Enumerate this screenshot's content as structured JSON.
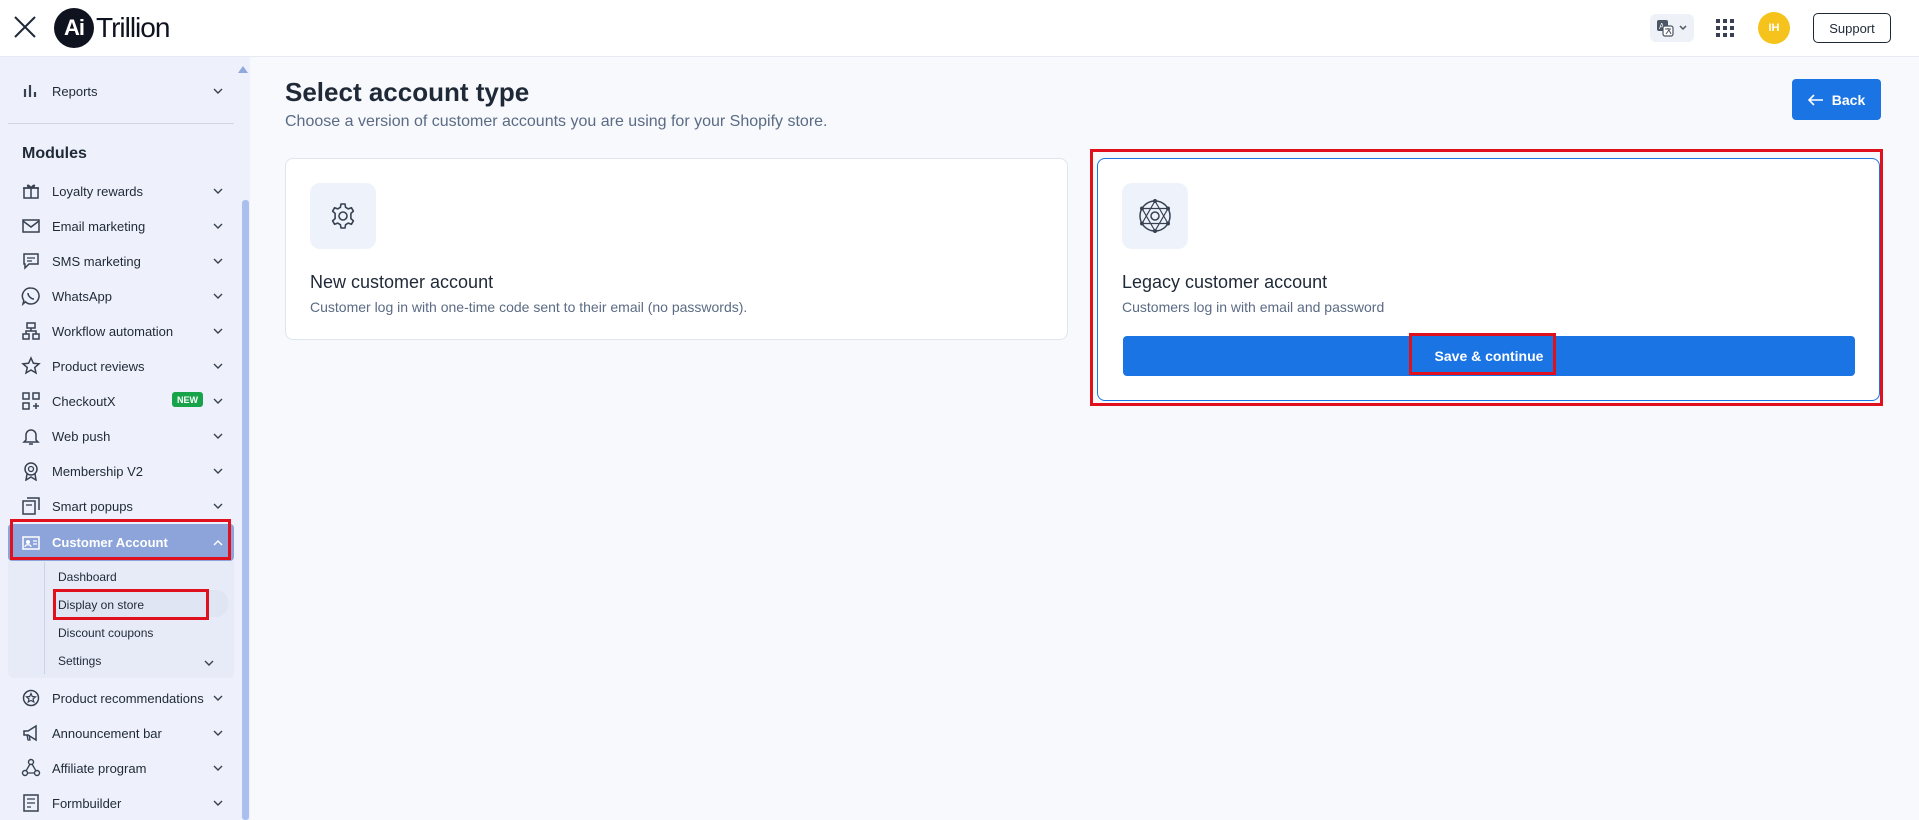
{
  "header": {
    "logo_mark": "Ai",
    "logo_text": "Trillion",
    "avatar_initials": "IH",
    "support_label": "Support"
  },
  "sidebar": {
    "top_item": "Reports",
    "modules_title": "Modules",
    "items": [
      {
        "label": "Loyalty rewards",
        "icon": "gift-icon"
      },
      {
        "label": "Email marketing",
        "icon": "mail-icon"
      },
      {
        "label": "SMS marketing",
        "icon": "chat-icon"
      },
      {
        "label": "WhatsApp",
        "icon": "whatsapp-icon"
      },
      {
        "label": "Workflow automation",
        "icon": "workflow-icon"
      },
      {
        "label": "Product reviews",
        "icon": "star-icon"
      },
      {
        "label": "CheckoutX",
        "icon": "grid-plus-icon",
        "badge": "NEW"
      },
      {
        "label": "Web push",
        "icon": "bell-icon"
      },
      {
        "label": "Membership V2",
        "icon": "medal-icon"
      },
      {
        "label": "Smart popups",
        "icon": "popup-icon"
      },
      {
        "label": "Customer Account",
        "icon": "id-card-icon",
        "active": true
      }
    ],
    "sub_items": [
      "Dashboard",
      "Display on store",
      "Discount coupons",
      "Settings"
    ],
    "bottom_items": [
      {
        "label": "Product recommendations",
        "icon": "badge-icon"
      },
      {
        "label": "Announcement bar",
        "icon": "megaphone-icon"
      },
      {
        "label": "Affiliate program",
        "icon": "network-icon"
      },
      {
        "label": "Formbuilder",
        "icon": "form-icon"
      }
    ]
  },
  "main": {
    "title": "Select account type",
    "subtitle": "Choose a version of customer accounts you are using for your Shopify store.",
    "back_label": "Back",
    "cards": [
      {
        "title": "New customer account",
        "description": "Customer log in with one-time code sent to their email (no passwords).",
        "icon": "gear-icon"
      },
      {
        "title": "Legacy customer account",
        "description": "Customers log in with email and password",
        "icon": "network-globe-icon",
        "selected": true
      }
    ],
    "save_label": "Save & continue"
  },
  "colors": {
    "accent": "#1b74e4",
    "highlight": "#e0101c",
    "badge": "#17a34a",
    "avatar": "#f6c31c",
    "sidebar_bg": "#eef1fb"
  }
}
